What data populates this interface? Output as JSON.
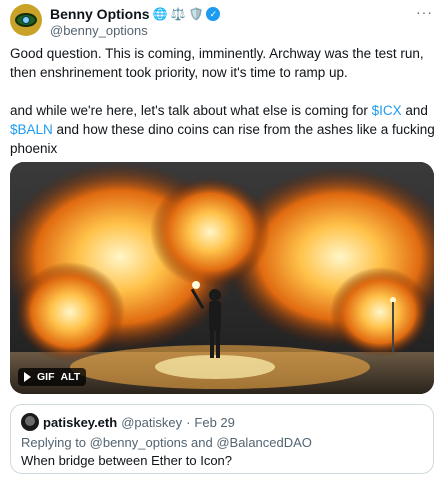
{
  "author": {
    "display_name": "Benny Options",
    "handle": "@benny_options",
    "badges": [
      "globe-icon",
      "scales-icon",
      "shield-icon"
    ],
    "verified": true
  },
  "tweet": {
    "line1": "Good question. This is coming, imminently. Archway was the test run,",
    "line2": "then enshrinement took priority, now it's time to ramp up.",
    "para2_pre": "and while we're here, let's talk about what else is coming for ",
    "cashtag1": "$ICX",
    "para2_mid": " and",
    "cashtag2": "$BALN",
    "para2_post": " and how these dino coins can rise from the ashes like a fucking",
    "para2_end": "phoenix"
  },
  "media": {
    "type_label": "GIF",
    "alt_label": "ALT"
  },
  "quote": {
    "display_name": "patiskey.eth",
    "handle": "@patiskey",
    "separator": "·",
    "date": "Feb 29",
    "replying_to": "Replying to @benny_options and @BalancedDAO",
    "text": "When bridge between Ether to Icon?"
  },
  "colors": {
    "link": "#1d9bf0",
    "secondary_text": "#536471",
    "border": "#cfd9de"
  }
}
